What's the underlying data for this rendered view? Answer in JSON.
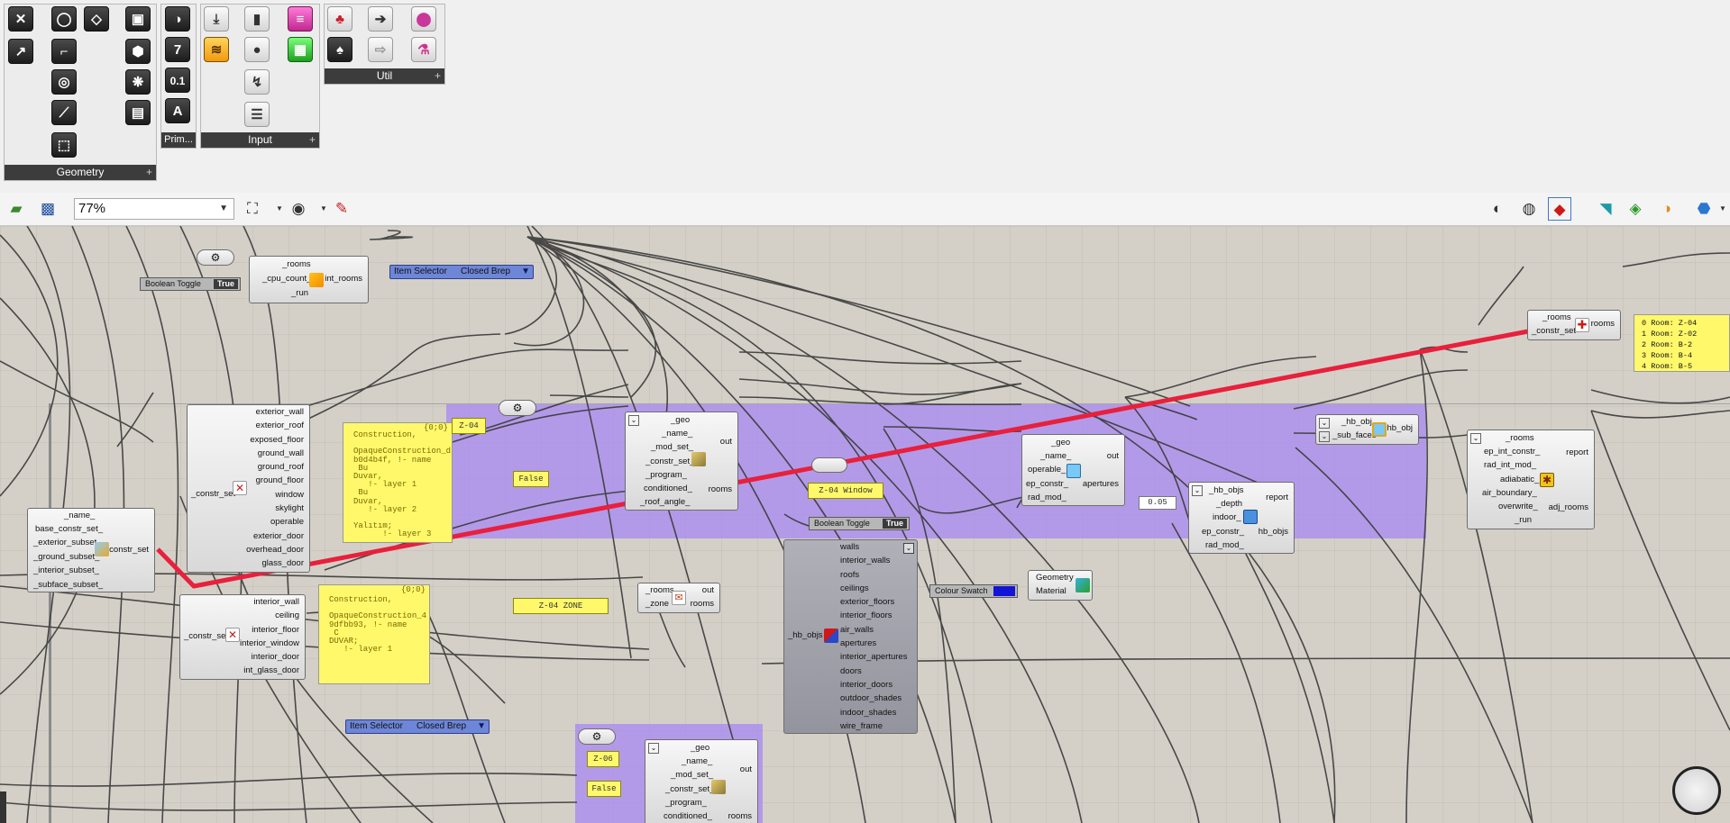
{
  "ribbon": {
    "panels": [
      {
        "label": "Geometry"
      },
      {
        "label": "Prim..."
      },
      {
        "label": "Input"
      },
      {
        "label": "Util"
      }
    ],
    "glyphs": {
      "seven": "7",
      "point_one": "0.1",
      "text_a": "A"
    }
  },
  "toolbar": {
    "zoom": "77%"
  },
  "canvas": {
    "top_selector": {
      "label": "Item Selector",
      "value": "Closed Brep"
    },
    "bottom_selector": {
      "label": "Item Selector",
      "value": "Closed Brep"
    },
    "toggle_top": {
      "label": "Boolean Toggle",
      "value": "True"
    },
    "toggle_mid": {
      "label": "Boolean Toggle",
      "value": "True"
    },
    "intersect": {
      "inputs": [
        "_rooms",
        "_cpu_count_",
        "_run"
      ],
      "outputs": [
        "int_rooms"
      ]
    },
    "constr_set": {
      "inputs": [
        "_name_",
        "base_constr_set_",
        "_exterior_subset_",
        "_ground_subset_",
        "_interior_subset_",
        "_subface_subset_"
      ],
      "outputs": [
        "constr_set"
      ]
    },
    "ext_subset": {
      "inputs": [
        "exterior_wall",
        "exterior_roof",
        "exposed_floor",
        "ground_wall",
        "ground_roof",
        "ground_floor",
        "window",
        "skylight",
        "operable",
        "exterior_door",
        "overhead_door",
        "glass_door"
      ],
      "outputs": [
        "_constr_set"
      ]
    },
    "int_subset": {
      "inputs": [
        "interior_wall",
        "ceiling",
        "interior_floor",
        "interior_window",
        "interior_door",
        "int_glass_door"
      ],
      "outputs": [
        "_constr_set"
      ]
    },
    "note1": {
      "header": "{0;0}",
      "text": "Construction,\n\nOpaqueConstruction_d\nb0d4b4f, !- name\n Bu\nDuvar,\n   !- layer 1\n Bu\nDuvar,\n   !- layer 2\n\nYalıtım;\n      !- layer 3"
    },
    "note2": {
      "header": "{0;0}",
      "text": "Construction,\n\nOpaqueConstruction_4\n9dfbb93, !- name\n C\nDUVAR;\n   !- layer 1"
    },
    "room_a": {
      "inputs": [
        "_geo",
        "_name_",
        "_mod_set_",
        "_constr_set_",
        "_program_",
        "conditioned_",
        "_roof_angle_"
      ],
      "outputs": [
        "out",
        "rooms"
      ]
    },
    "room_b": {
      "inputs": [
        "_geo",
        "_name_",
        "_mod_set_",
        "_constr_set_",
        "_program_",
        "conditioned_"
      ],
      "outputs": [
        "out",
        "rooms"
      ]
    },
    "tags": {
      "z04": "Z-04",
      "false_a": "False",
      "z04_window": "Z-04 Window",
      "z04_zone": "Z-04 ZONE",
      "z06": "Z-06",
      "false_b": "False",
      "num": "0.05"
    },
    "zone_comp": {
      "inputs": [
        "_rooms",
        "_zone"
      ],
      "outputs": [
        "out",
        "rooms"
      ]
    },
    "deconstruct": {
      "inputs": [
        "_hb_objs"
      ],
      "outputs": [
        "walls",
        "interior_walls",
        "roofs",
        "ceilings",
        "exterior_floors",
        "interior_floors",
        "air_walls",
        "apertures",
        "interior_apertures",
        "doors",
        "interior_doors",
        "outdoor_shades",
        "indoor_shades",
        "wire_frame"
      ]
    },
    "colour_swatch": {
      "label": "Colour Swatch"
    },
    "preview": {
      "inputs": [
        "Geometry",
        "Material"
      ]
    },
    "aperture": {
      "inputs": [
        "_geo",
        "_name_",
        "operable_",
        "ep_constr_",
        "rad_mod_"
      ],
      "outputs": [
        "out",
        "apertures"
      ]
    },
    "add_subface": {
      "inputs": [
        "_hb_obj",
        "_sub_faces"
      ],
      "outputs": [
        "hb_obj"
      ]
    },
    "louver": {
      "inputs": [
        "_hb_objs",
        "_depth",
        "indoor_",
        "ep_constr_",
        "rad_mod_"
      ],
      "outputs": [
        "report",
        "hb_objs"
      ]
    },
    "solve_adj": {
      "inputs": [
        "_rooms",
        "ep_int_constr_",
        "rad_int_mod_",
        "adiabatic_",
        "air_boundary_",
        "overwrite_",
        "_run"
      ],
      "outputs": [
        "report",
        "adj_rooms"
      ]
    },
    "apply_constr": {
      "inputs": [
        "_rooms",
        "_constr_set"
      ],
      "outputs": [
        "rooms"
      ]
    },
    "output_panel": {
      "lines": [
        "0 Room: Z-04",
        "1 Room: Z-02",
        "2 Room: B-2",
        "3 Room: B-4",
        "4 Room: B-5"
      ]
    }
  },
  "colors": {
    "canvas": "#d4d0c8",
    "group": "#aa8cf0",
    "note": "#fff86a",
    "selector": "#6e86d8",
    "wire_highlight": "#e8203c",
    "swatch": "#1414d4"
  }
}
